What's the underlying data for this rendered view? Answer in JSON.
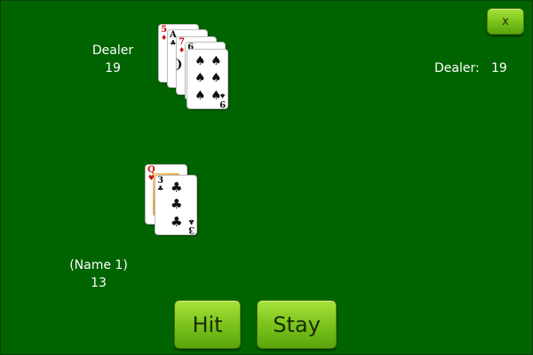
{
  "dealer": {
    "label": "Dealer",
    "score": "19"
  },
  "status": {
    "label": "Dealer:",
    "value": "19"
  },
  "player": {
    "name": "(Name 1)",
    "score": "13"
  },
  "buttons": {
    "close": "x",
    "hit": "Hit",
    "stay": "Stay"
  },
  "dealer_cards": [
    {
      "rank": "5",
      "suit": "♦"
    },
    {
      "rank": "A",
      "suit": "♣"
    },
    {
      "rank": "7",
      "suit": "♦"
    },
    {
      "rank": "6",
      "suit": "♠"
    },
    {
      "rank": "9",
      "suit": "♠"
    }
  ],
  "player_cards": [
    {
      "rank": "Q",
      "suit": "♥"
    },
    {
      "rank": "3",
      "suit": "♣"
    }
  ],
  "colors": {
    "felt": "#006400",
    "button_green": "#7cc41d"
  }
}
